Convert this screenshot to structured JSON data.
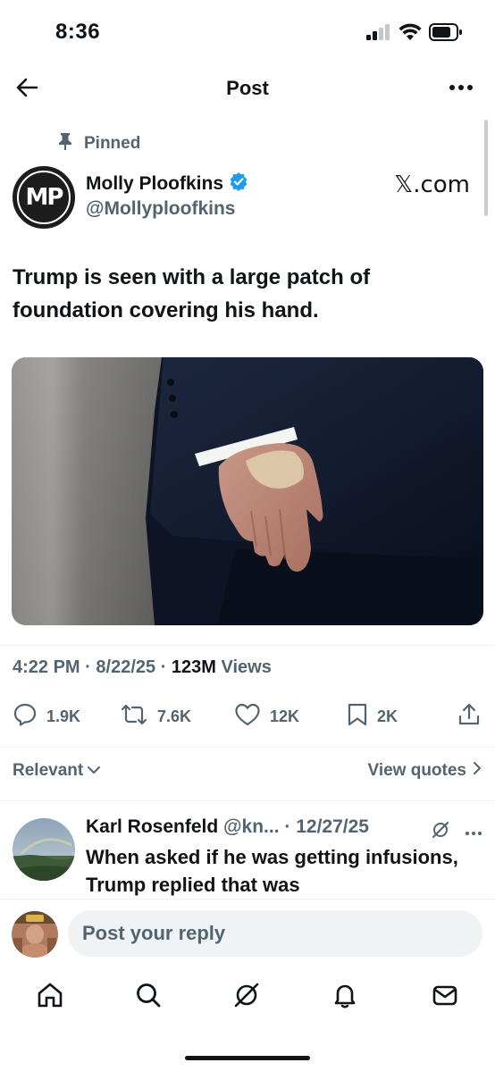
{
  "status": {
    "time": "8:36"
  },
  "nav": {
    "title": "Post"
  },
  "post": {
    "pinned_label": "Pinned",
    "author_name": "Molly Ploofkins",
    "author_handle": "@Mollyploofkins",
    "avatar_initials": "MP",
    "watermark": "𝕏.com",
    "text": "Trump is seen with a large patch of foundation covering his hand.",
    "time": "4:22 PM",
    "date": "8/22/25",
    "views_count": "123M",
    "views_label": "Views",
    "sep": "·"
  },
  "actions": {
    "replies": "1.9K",
    "reposts": "7.6K",
    "likes": "12K",
    "bookmarks": "2K"
  },
  "filters": {
    "sort_label": "Relevant",
    "quotes_label": "View quotes"
  },
  "reply": {
    "name": "Karl Rosenfeld",
    "handle": "@kn...",
    "date": "12/27/25",
    "sep": "·",
    "text": "When asked if he was getting infusions, Trump replied that was"
  },
  "composer": {
    "placeholder": "Post your reply"
  },
  "colors": {
    "accent": "#1d9bf0",
    "text": "#0f1419",
    "secondary": "#536471",
    "divider": "#eff3f4"
  },
  "icons": {
    "status": [
      "cellular-signal-icon",
      "wifi-icon",
      "battery-icon"
    ],
    "nav": [
      "back-arrow-icon",
      "more-icon"
    ],
    "actions": [
      "reply-icon",
      "repost-icon",
      "like-icon",
      "bookmark-icon",
      "share-icon"
    ],
    "tabs": [
      "home-icon",
      "search-icon",
      "grok-icon",
      "notifications-icon",
      "messages-icon"
    ]
  }
}
